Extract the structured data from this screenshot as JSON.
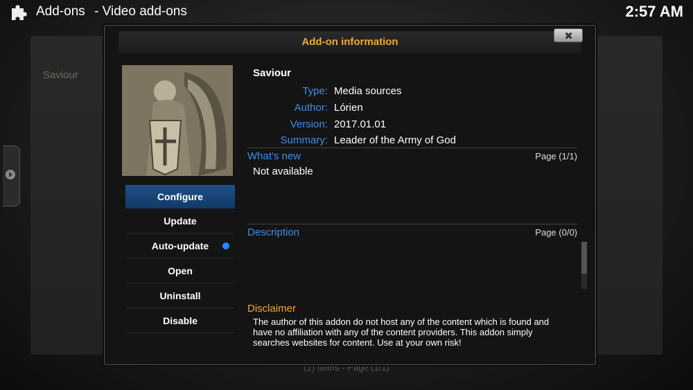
{
  "header": {
    "section": "Add-ons",
    "separator": "-",
    "subsection": "Video add-ons",
    "clock": "2:57 AM"
  },
  "background": {
    "list_item": "Saviour",
    "footer": "(1) Items - Page (1/1)"
  },
  "dialog": {
    "title": "Add-on information",
    "addon": {
      "name": "Saviour",
      "type_label": "Type:",
      "type": "Media sources",
      "author_label": "Author:",
      "author": "Lórien",
      "version_label": "Version:",
      "version": "2017.01.01",
      "summary_label": "Summary:",
      "summary": "Leader of the Army of God"
    },
    "whats_new": {
      "label": "What's new",
      "page": "Page (1/1)",
      "text": "Not available"
    },
    "description": {
      "label": "Description",
      "page": "Page (0/0)"
    },
    "disclaimer": {
      "label": "Disclaimer",
      "text": "The author of this addon do not host any of the content which is found and have no affiliation with any of the content providers. This addon simply searches websites for content. Use at your own risk!"
    },
    "menu": {
      "configure": "Configure",
      "update": "Update",
      "auto_update": "Auto-update",
      "open": "Open",
      "uninstall": "Uninstall",
      "disable": "Disable"
    }
  },
  "icons": {
    "addon": "puzzle-icon",
    "close": "close-icon",
    "side": "arrow-right-icon"
  },
  "colors": {
    "accent_orange": "#f0a835",
    "label_blue": "#3d8eea",
    "selected_blue": "#1d4f88"
  }
}
